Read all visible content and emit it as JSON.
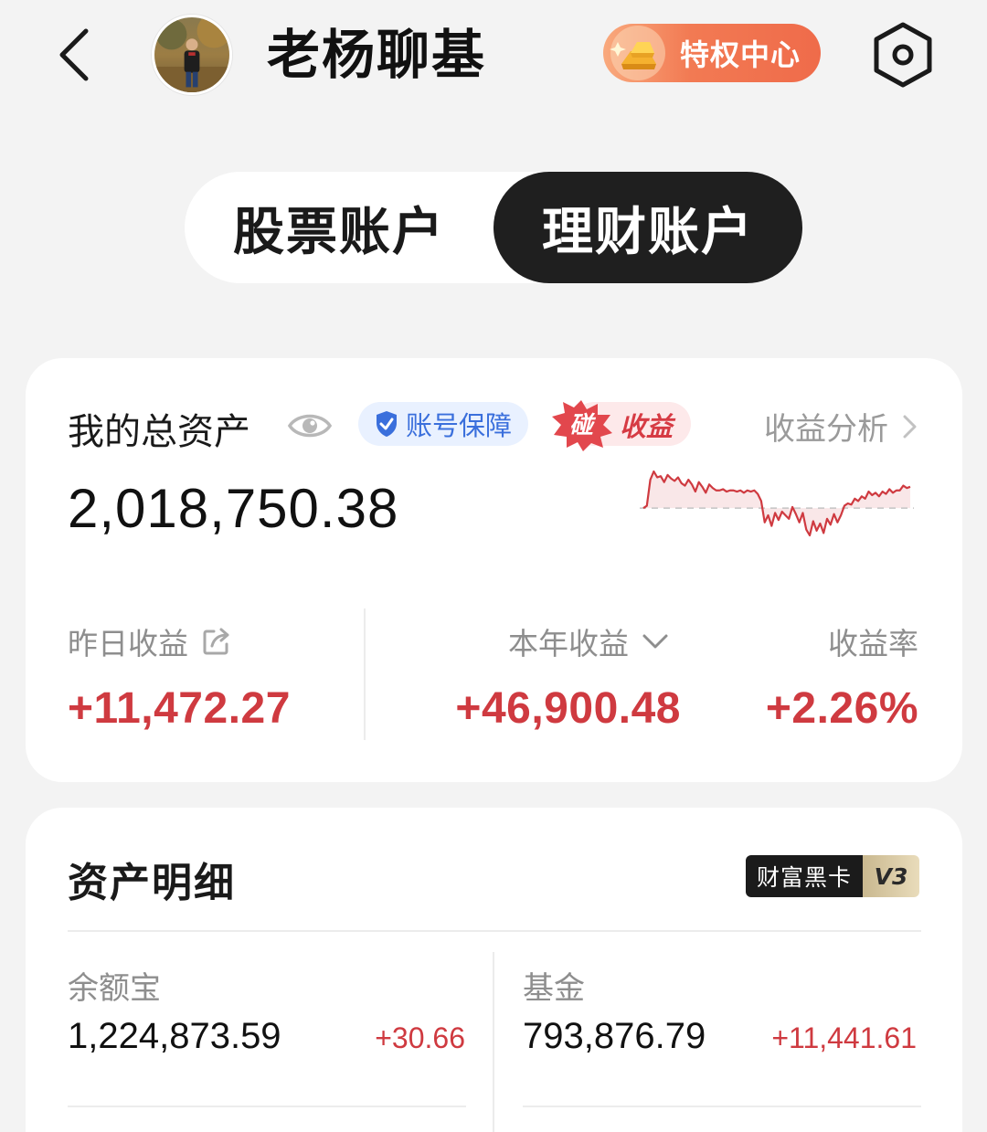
{
  "header": {
    "back_label": "back",
    "title": "老杨聊基",
    "privilege_label": "特权中心"
  },
  "tabs": {
    "stock_label": "股票账户",
    "wealth_label": "理财账户",
    "selected": "理财账户"
  },
  "summary": {
    "title": "我的总资产",
    "guard_label": "账号保障",
    "earn_badge_icon_text": "碰",
    "earn_badge_label": "收益",
    "analysis_label": "收益分析",
    "total_assets": "2,018,750.38",
    "yesterday_label": "昨日收益",
    "yesterday_value": "+11,472.27",
    "year_label": "本年收益",
    "year_value": "+46,900.48",
    "rate_label": "收益率",
    "rate_value": "+2.26%"
  },
  "trend": {
    "baseline": 0,
    "values": [
      0,
      0.2,
      2.4,
      3.1,
      2.6,
      2.7,
      2.2,
      2.8,
      2.5,
      2.3,
      2.6,
      2.1,
      1.9,
      2.4,
      2.0,
      1.4,
      2.2,
      1.8,
      1.3,
      2.0,
      1.7,
      1.5,
      1.5,
      1.6,
      1.4,
      1.5,
      1.5,
      1.4,
      1.5,
      1.3,
      1.5,
      1.4,
      1.5,
      1.2,
      0.6,
      -1.2,
      -0.6,
      -1.5,
      -0.4,
      -1.0,
      -0.3,
      -0.6,
      -0.9,
      0.1,
      -0.5,
      -1.2,
      -0.4,
      -1.8,
      -2.3,
      -1.1,
      -1.9,
      -1.3,
      -2.1,
      -0.9,
      -1.4,
      -0.5,
      -1.2,
      -0.6,
      0.2,
      0.4,
      0.3,
      0.8,
      0.6,
      1.0,
      0.8,
      1.4,
      1.1,
      1.3,
      1.0,
      1.4,
      1.2,
      1.6,
      1.3,
      1.5,
      1.5,
      1.9,
      1.7,
      1.8
    ],
    "color": "#cf3a40"
  },
  "details": {
    "title": "资产明细",
    "black_card_label": "财富黑卡",
    "black_card_level": "V3",
    "items": [
      {
        "name": "余额宝",
        "amount": "1,224,873.59",
        "change": "+30.66"
      },
      {
        "name": "基金",
        "amount": "793,876.79",
        "change": "+11,441.61"
      }
    ]
  },
  "colors": {
    "accent_red": "#cf3a40",
    "guard_blue": "#3a6fdc",
    "tab_selected_bg": "#1f1f1f",
    "page_bg": "#f3f3f3"
  }
}
